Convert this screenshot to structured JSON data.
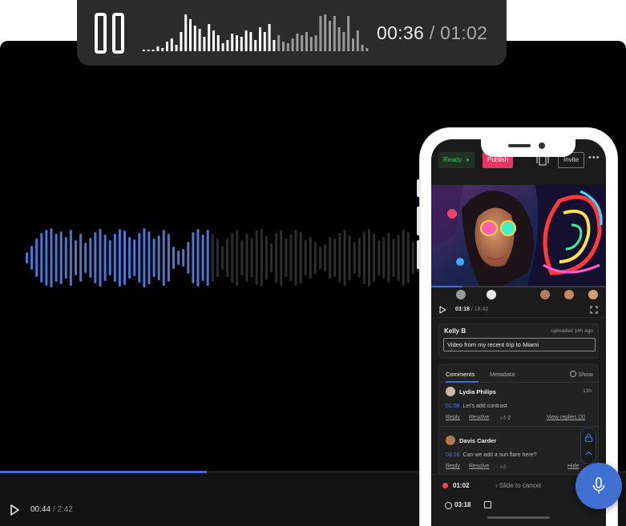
{
  "recorder": {
    "elapsed": "00:36",
    "separator": "/",
    "duration": "01:02",
    "progress": 0.58
  },
  "player": {
    "current_time": "00:44",
    "separator": "/",
    "duration": "2:42",
    "progress": 0.33
  },
  "phone": {
    "status_label": "Ready",
    "publish_label": "Publish",
    "invite_label": "Invite",
    "more_label": "•••",
    "media_current_time": "03:18",
    "media_separator": "/",
    "media_duration": "18:42",
    "media_progress": 0.18,
    "asset": {
      "uploader": "Kelly B",
      "uploaded": "uploaded 14h ago",
      "title": "Video from my recent trip to Miami"
    },
    "tabs": [
      {
        "label": "Comments"
      },
      {
        "label": "Metadata"
      }
    ],
    "show_label": "Show",
    "comments": [
      {
        "author": "Lydia Philips",
        "when": "13h",
        "timestamp": "01:06",
        "text": "Let's add contrast",
        "reply_label": "Reply",
        "resolve_label": "Resolve",
        "likes": "2",
        "replies_label": "View replies (3)"
      },
      {
        "author": "Davis Carder",
        "when": "",
        "timestamp": "03:18",
        "text": "Can we add a sun flare here?",
        "reply_label": "Reply",
        "resolve_label": "Resolve",
        "likes": "",
        "hide_label": "Hide"
      }
    ],
    "recording": {
      "elapsed": "01:02",
      "slide_label": "Slide to cancel",
      "timecode": "03:18"
    }
  },
  "colors": {
    "accent": "#3f6fd0",
    "publish": "#ec3563",
    "ready": "#2fc267",
    "record": "#ff3b4e",
    "wave_played": "#4a77d4",
    "wave_unplayed": "#2e2e2e"
  },
  "icons": {
    "pause": "pause-icon",
    "play": "play-icon",
    "mic": "microphone-icon",
    "lock": "lock-icon",
    "fullscreen": "fullscreen-icon",
    "compare": "compare-icon"
  }
}
